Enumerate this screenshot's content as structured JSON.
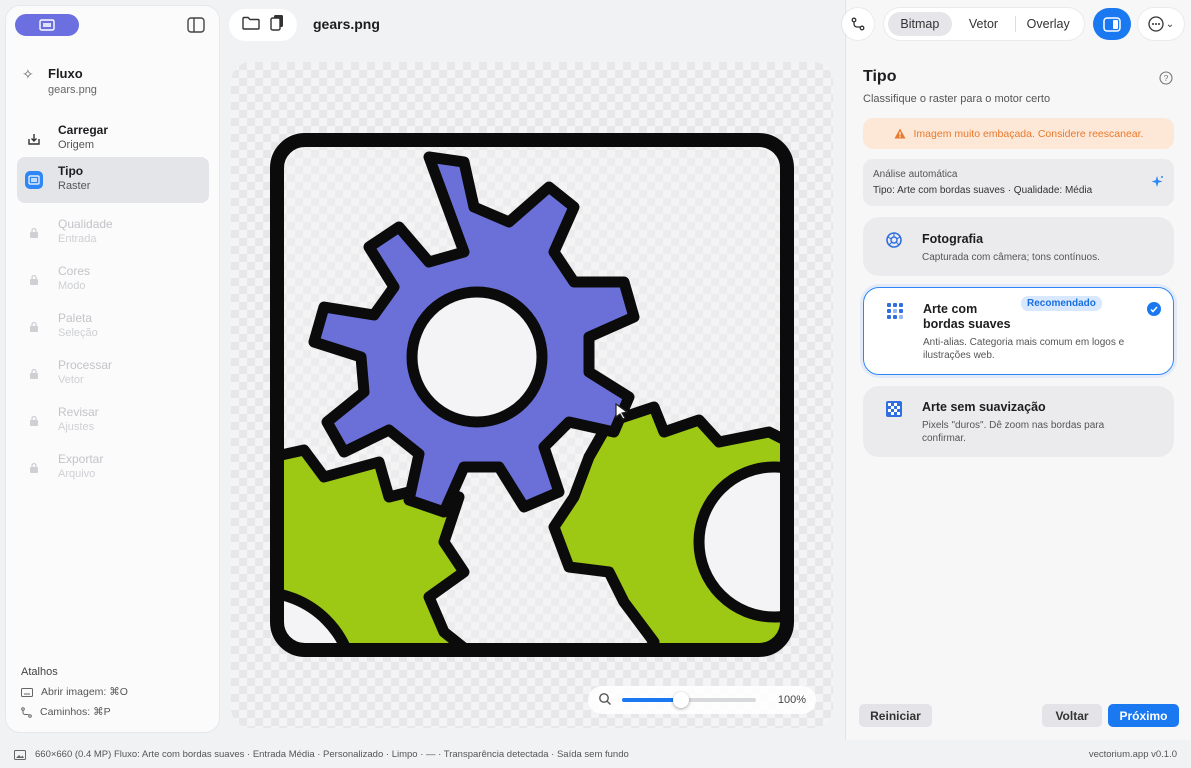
{
  "sidebar": {
    "flow_title": "Fluxo",
    "flow_file": "gears.png",
    "steps": [
      {
        "label": "Carregar",
        "sub": "Origem"
      },
      {
        "label": "Tipo",
        "sub": "Raster"
      },
      {
        "label": "Qualidade",
        "sub": "Entrada"
      },
      {
        "label": "Cores",
        "sub": "Modo"
      },
      {
        "label": "Paleta",
        "sub": "Seleção"
      },
      {
        "label": "Processar",
        "sub": "Vetor"
      },
      {
        "label": "Revisar",
        "sub": "Ajustes"
      },
      {
        "label": "Exportar",
        "sub": "Arquivo"
      }
    ],
    "shortcuts_title": "Atalhos",
    "shortcuts": [
      {
        "label": "Abrir imagem: ⌘O",
        "icon": "keyboard-icon"
      },
      {
        "label": "Caminhos: ⌘P",
        "icon": "path-icon"
      }
    ]
  },
  "toolbar": {
    "filename": "gears.png"
  },
  "canvas": {
    "zoom": "100%",
    "zoom_fraction": 0.44
  },
  "right": {
    "view_modes": [
      "Bitmap",
      "Vetor",
      "Overlay"
    ],
    "selected_view": "Bitmap",
    "title": "Tipo",
    "subtitle": "Classifique o raster para o motor certo",
    "warning": "Imagem muito embaçada. Considere reescanear.",
    "auto_title": "Análise automática",
    "auto_value": "Tipo: Arte com bordas suaves · Qualidade: Média",
    "options": [
      {
        "title": "Fotografia",
        "desc": "Capturada com câmera; tons contínuos.",
        "icon": "aperture-icon"
      },
      {
        "title": "Arte com bordas suaves",
        "badge": "Recomendado",
        "desc": "Anti-alias. Categoria mais comum em logos e ilustrações web.",
        "icon": "grid-dots-icon",
        "selected": true
      },
      {
        "title": "Arte sem suavização",
        "desc": "Pixels \"duros\". Dê zoom nas bordas para confirmar.",
        "icon": "checker-icon"
      }
    ],
    "btn_reset": "Reiniciar",
    "btn_back": "Voltar",
    "btn_next": "Próximo"
  },
  "status": {
    "left": "660×660 (0.4 MP)   Fluxo: Arte com bordas suaves · Entrada Média · Personalizado · Limpo · — · Transparência detectada · Saída sem fundo",
    "right": "vectorium.app   v0.1.0"
  },
  "colors": {
    "accent": "#1a78f0",
    "gear_blue": "#6a70d8",
    "gear_green": "#9dc915",
    "warning_bg": "#fde8d7",
    "warning_fg": "#e8792d"
  }
}
